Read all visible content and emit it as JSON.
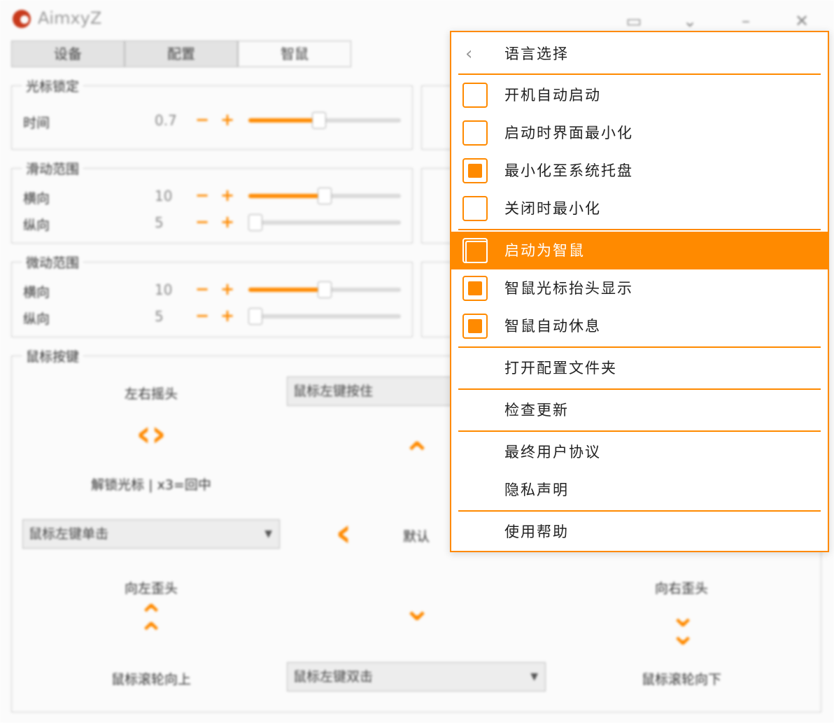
{
  "app": {
    "title": "AimxyZ",
    "tabs": [
      {
        "label": "设备"
      },
      {
        "label": "配置"
      },
      {
        "label": "智鼠"
      }
    ],
    "cursor_lock": {
      "title": "光标锁定",
      "time_label": "时间",
      "time_value": "0.7",
      "time_level": 0.46
    },
    "slide_range": {
      "title": "滑动范围",
      "h_label": "横向",
      "h_value": "10",
      "h_level": 0.5,
      "v_label": "纵向",
      "v_value": "5",
      "v_level": 0.0
    },
    "micro_range": {
      "title": "微动范围",
      "h_label": "横向",
      "h_value": "10",
      "h_level": 0.5,
      "v_label": "纵向",
      "v_value": "5",
      "v_level": 0.0
    },
    "mouse_buttons": {
      "title": "鼠标按键",
      "lr_shake_label": "左右摇头",
      "unlock_label": "解锁光标 | x3=回中",
      "combo_top": "鼠标左键按住",
      "combo_left": "鼠标左键单击",
      "default_label": "默认",
      "turn_left_label": "向左歪头",
      "turn_right_label": "向右歪头",
      "wheel_up_label": "鼠标滚轮向上",
      "wheel_down_label": "鼠标滚轮向下",
      "combo_bottom": "鼠标左键双击"
    },
    "pm": {
      "minus": "−",
      "plus": "+"
    }
  },
  "menu": {
    "language_label": "语言选择",
    "items": [
      {
        "label": "开机自动启动",
        "checked": false
      },
      {
        "label": "启动时界面最小化",
        "checked": false
      },
      {
        "label": "最小化至系统托盘",
        "checked": true
      },
      {
        "label": "关闭时最小化",
        "checked": false
      },
      {
        "label": "启动为智鼠",
        "checked": false,
        "highlighted": true
      },
      {
        "label": "智鼠光标抬头显示",
        "checked": true
      },
      {
        "label": "智鼠自动休息",
        "checked": true
      }
    ],
    "open_config_folder": "打开配置文件夹",
    "check_updates": "检查更新",
    "eula": "最终用户协议",
    "privacy": "隐私声明",
    "help": "使用帮助"
  },
  "colors": {
    "accent": "#ff8a00"
  }
}
